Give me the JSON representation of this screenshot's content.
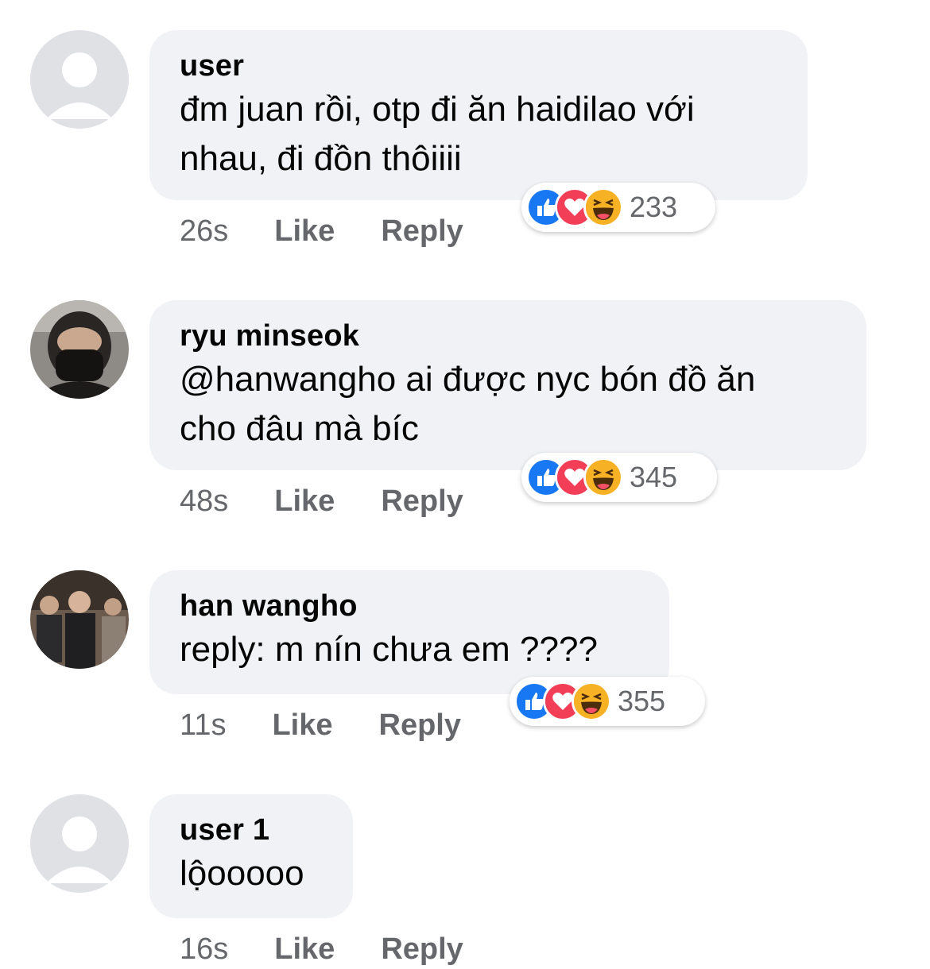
{
  "colors": {
    "bubble": "#f0f2f5",
    "meta_text": "#65676b",
    "like_blue": "#1877f2",
    "love_red": "#f33e58",
    "haha_yellow": "#f7b125"
  },
  "comments": [
    {
      "author": "user",
      "text_lines": [
        "đm juan rồi, otp đi ăn haidilao với",
        "nhau, đi đồn thôiiii"
      ],
      "time": "26s",
      "like": "Like",
      "reply": "Reply",
      "reaction_icons": [
        "like-icon",
        "love-icon",
        "haha-icon"
      ],
      "reaction_count": "233",
      "avatar": "default-avatar"
    },
    {
      "author": "ryu minseok",
      "text_lines": [
        "@hanwangho ai được nyc bón đồ ăn",
        "cho đâu mà bíc"
      ],
      "time": "48s",
      "like": "Like",
      "reply": "Reply",
      "reaction_icons": [
        "like-icon",
        "love-icon",
        "haha-icon"
      ],
      "reaction_count": "345",
      "avatar": "photo-avatar"
    },
    {
      "author": "han wangho",
      "text_lines": [
        "reply: m nín chưa em ????"
      ],
      "time": "11s",
      "like": "Like",
      "reply": "Reply",
      "reaction_icons": [
        "like-icon",
        "love-icon",
        "haha-icon"
      ],
      "reaction_count": "355",
      "avatar": "photo-avatar"
    },
    {
      "author": "user 1",
      "text_lines": [
        "lộooooo"
      ],
      "time": "16s",
      "like": "Like",
      "reply": "Reply",
      "avatar": "default-avatar"
    }
  ]
}
